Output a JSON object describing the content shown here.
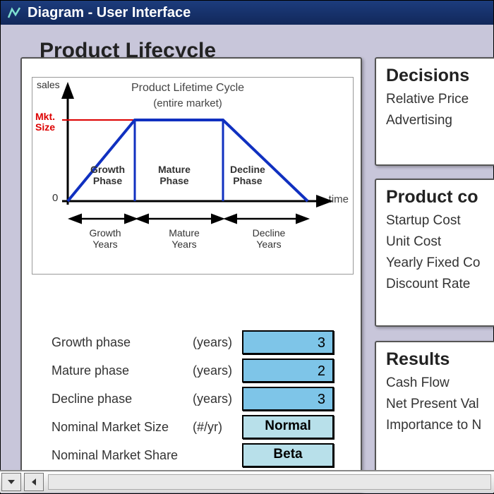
{
  "window": {
    "title": "Diagram - User Interface"
  },
  "left": {
    "title": "Product Lifecycle",
    "diagram": {
      "title": "Product Lifetime Cycle",
      "subtitle": "(entire market)",
      "y_axis_label": "sales",
      "x_axis_label": "time",
      "mkt_size_label_1": "Mkt.",
      "mkt_size_label_2": "Size",
      "zero_label": "0",
      "phase_growth_1": "Growth",
      "phase_growth_2": "Phase",
      "phase_mature_1": "Mature",
      "phase_mature_2": "Phase",
      "phase_decline_1": "Decline",
      "phase_decline_2": "Phase",
      "yrs_growth_1": "Growth",
      "yrs_growth_2": "Years",
      "yrs_mature_1": "Mature",
      "yrs_mature_2": "Years",
      "yrs_decline_1": "Decline",
      "yrs_decline_2": "Years"
    },
    "inputs": {
      "growth_label": "Growth phase",
      "growth_unit": "(years)",
      "growth_value": "3",
      "mature_label": "Mature phase",
      "mature_unit": "(years)",
      "mature_value": "2",
      "decline_label": "Decline phase",
      "decline_unit": "(years)",
      "decline_value": "3",
      "nms_label": "Nominal Market Size",
      "nms_unit": "(#/yr)",
      "nms_value": "Normal",
      "share_label": "Nominal Market Share",
      "share_unit": "",
      "share_value": "Beta"
    }
  },
  "right": {
    "decisions": {
      "title": "Decisions",
      "items": [
        "Relative Price",
        "Advertising"
      ]
    },
    "costs": {
      "title": "Product co",
      "items": [
        "Startup Cost",
        "Unit Cost",
        "Yearly Fixed Co",
        "Discount Rate"
      ]
    },
    "results": {
      "title": "Results",
      "items": [
        "Cash Flow",
        "Net Present Val",
        "Importance to N"
      ]
    }
  },
  "chart_data": {
    "type": "line",
    "title": "Product Lifetime Cycle (entire market)",
    "xlabel": "time",
    "ylabel": "sales",
    "annotations": [
      "Mkt. Size"
    ],
    "segments": [
      {
        "name": "Growth Phase",
        "shape": "ramp-up"
      },
      {
        "name": "Mature Phase",
        "shape": "plateau"
      },
      {
        "name": "Decline Phase",
        "shape": "ramp-down"
      }
    ],
    "x": [
      0,
      1,
      2,
      3
    ],
    "y": [
      0,
      1,
      1,
      0
    ],
    "ylim": [
      0,
      1
    ],
    "x_phase_spans": [
      "Growth Years",
      "Mature Years",
      "Decline Years"
    ]
  }
}
